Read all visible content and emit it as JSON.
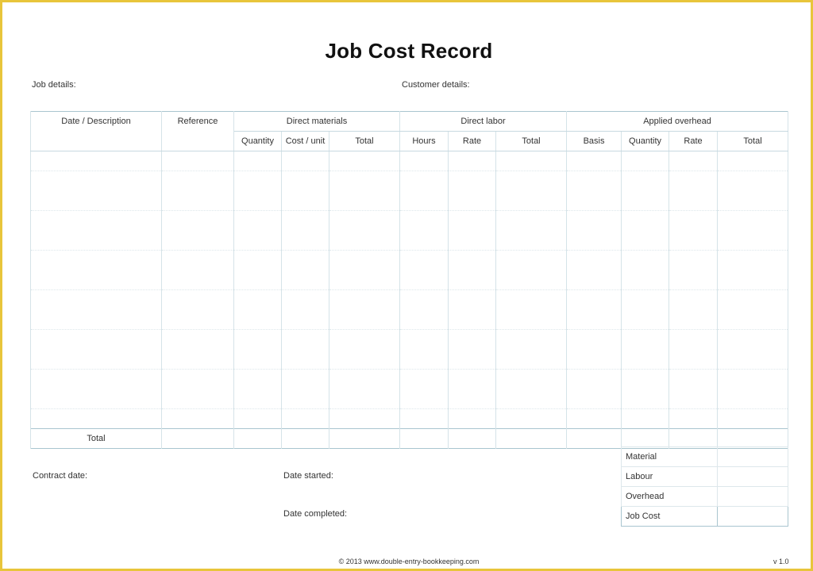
{
  "title": "Job Cost Record",
  "labels": {
    "job_details": "Job details:",
    "customer_details": "Customer details:",
    "contract_date": "Contract date:",
    "date_started": "Date started:",
    "date_completed": "Date completed:"
  },
  "table": {
    "headers": {
      "date_description": "Date / Description",
      "reference": "Reference",
      "direct_materials": "Direct materials",
      "direct_labor": "Direct labor",
      "applied_overhead": "Applied overhead"
    },
    "subheaders": {
      "quantity": "Quantity",
      "cost_unit": "Cost / unit",
      "total": "Total",
      "hours": "Hours",
      "rate": "Rate",
      "basis": "Basis"
    },
    "total_row_label": "Total"
  },
  "summary": {
    "material": "Material",
    "labour": "Labour",
    "overhead": "Overhead",
    "job_cost": "Job Cost"
  },
  "footer": {
    "copyright": "© 2013 www.double-entry-bookkeeping.com",
    "version": "v 1.0"
  },
  "colors": {
    "frame_border": "#e8c53b",
    "grid_line": "#a9c5cf"
  }
}
